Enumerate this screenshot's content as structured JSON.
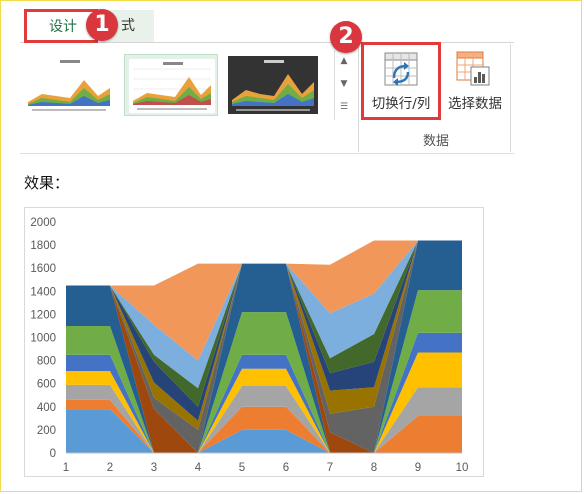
{
  "ribbon": {
    "tabs": [
      {
        "label": "设计",
        "active": true
      },
      {
        "label": "格式",
        "visible_text": "式",
        "active": false
      }
    ],
    "gallery_thumbnails": [
      "style-1",
      "style-2-selected",
      "style-3-dark"
    ],
    "commands": [
      {
        "label": "切换行/列",
        "icon": "switch-row-column-icon"
      },
      {
        "label": "选择数据",
        "icon": "select-data-icon"
      }
    ],
    "group_label": "数据",
    "callouts": [
      "1",
      "2"
    ],
    "accent_colors": {
      "tab_text": "#217346",
      "callout": "#d9363e",
      "highlight": "#e03a3a"
    }
  },
  "content": {
    "result_label": "效果："
  },
  "chart_data": {
    "type": "area",
    "stacked": true,
    "x": [
      1,
      2,
      3,
      4,
      5,
      6,
      7,
      8,
      9,
      10
    ],
    "ylim": [
      0,
      2000
    ],
    "yticks": [
      0,
      200,
      400,
      600,
      800,
      1000,
      1200,
      1400,
      1600,
      1800,
      2000
    ],
    "grid": false,
    "legend": "none",
    "series": [
      {
        "color": "#5b9bd5",
        "values": [
          380,
          380,
          0,
          0,
          200,
          200,
          0,
          0,
          0,
          0
        ]
      },
      {
        "color": "#ed7d31",
        "values": [
          80,
          80,
          0,
          0,
          200,
          200,
          0,
          0,
          320,
          320
        ]
      },
      {
        "color": "#a5a5a5",
        "values": [
          130,
          130,
          0,
          0,
          180,
          180,
          0,
          0,
          250,
          250
        ]
      },
      {
        "color": "#ffc000",
        "values": [
          120,
          120,
          0,
          0,
          150,
          150,
          0,
          0,
          300,
          300
        ]
      },
      {
        "color": "#4472c4",
        "values": [
          140,
          140,
          0,
          0,
          120,
          120,
          0,
          0,
          170,
          170
        ]
      },
      {
        "color": "#70ad47",
        "values": [
          250,
          250,
          0,
          0,
          370,
          370,
          0,
          0,
          370,
          370
        ]
      },
      {
        "color": "#255e91",
        "values": [
          350,
          350,
          0,
          0,
          420,
          420,
          0,
          0,
          430,
          430
        ]
      },
      {
        "color": "#9e480e",
        "values": [
          0,
          0,
          380,
          0,
          0,
          0,
          180,
          0,
          0,
          0
        ]
      },
      {
        "color": "#636363",
        "values": [
          0,
          0,
          100,
          200,
          0,
          0,
          160,
          400,
          0,
          0
        ]
      },
      {
        "color": "#997300",
        "values": [
          0,
          0,
          130,
          80,
          0,
          0,
          200,
          170,
          0,
          0
        ]
      },
      {
        "color": "#264478",
        "values": [
          0,
          0,
          180,
          120,
          0,
          0,
          150,
          220,
          0,
          0
        ]
      },
      {
        "color": "#43682b",
        "values": [
          0,
          0,
          60,
          160,
          0,
          0,
          130,
          240,
          0,
          0
        ]
      },
      {
        "color": "#7cafdd",
        "values": [
          0,
          0,
          260,
          240,
          0,
          0,
          390,
          350,
          0,
          0
        ]
      },
      {
        "color": "#f1975a",
        "values": [
          0,
          0,
          340,
          840,
          0,
          0,
          420,
          460,
          0,
          0
        ]
      }
    ]
  }
}
